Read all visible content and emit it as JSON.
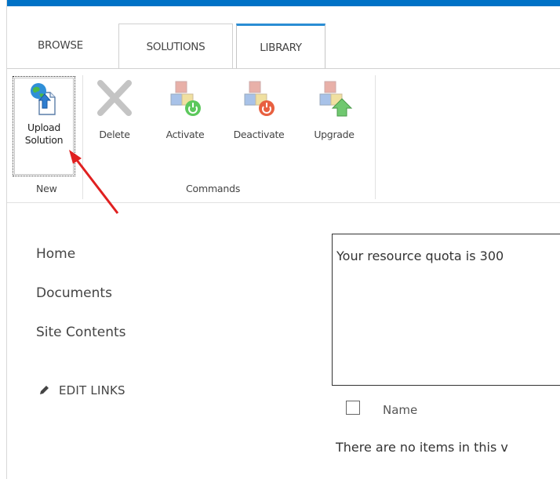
{
  "tabs": {
    "browse": "BROWSE",
    "solutions": "SOLUTIONS",
    "library": "LIBRARY"
  },
  "ribbon": {
    "buttons": {
      "upload_line1": "Upload",
      "upload_line2": "Solution",
      "delete": "Delete",
      "activate": "Activate",
      "deactivate": "Deactivate",
      "upgrade": "Upgrade"
    },
    "groups": {
      "new": "New",
      "commands": "Commands"
    }
  },
  "quick_launch": {
    "items": [
      "Home",
      "Documents",
      "Site Contents"
    ],
    "edit_links": "EDIT LINKS"
  },
  "main": {
    "quota_text": "Your resource quota is 300",
    "column_name": "Name",
    "empty_message": "There are no items in this v"
  },
  "colors": {
    "accent": "#0072c6",
    "annotation_arrow": "#e02020"
  }
}
